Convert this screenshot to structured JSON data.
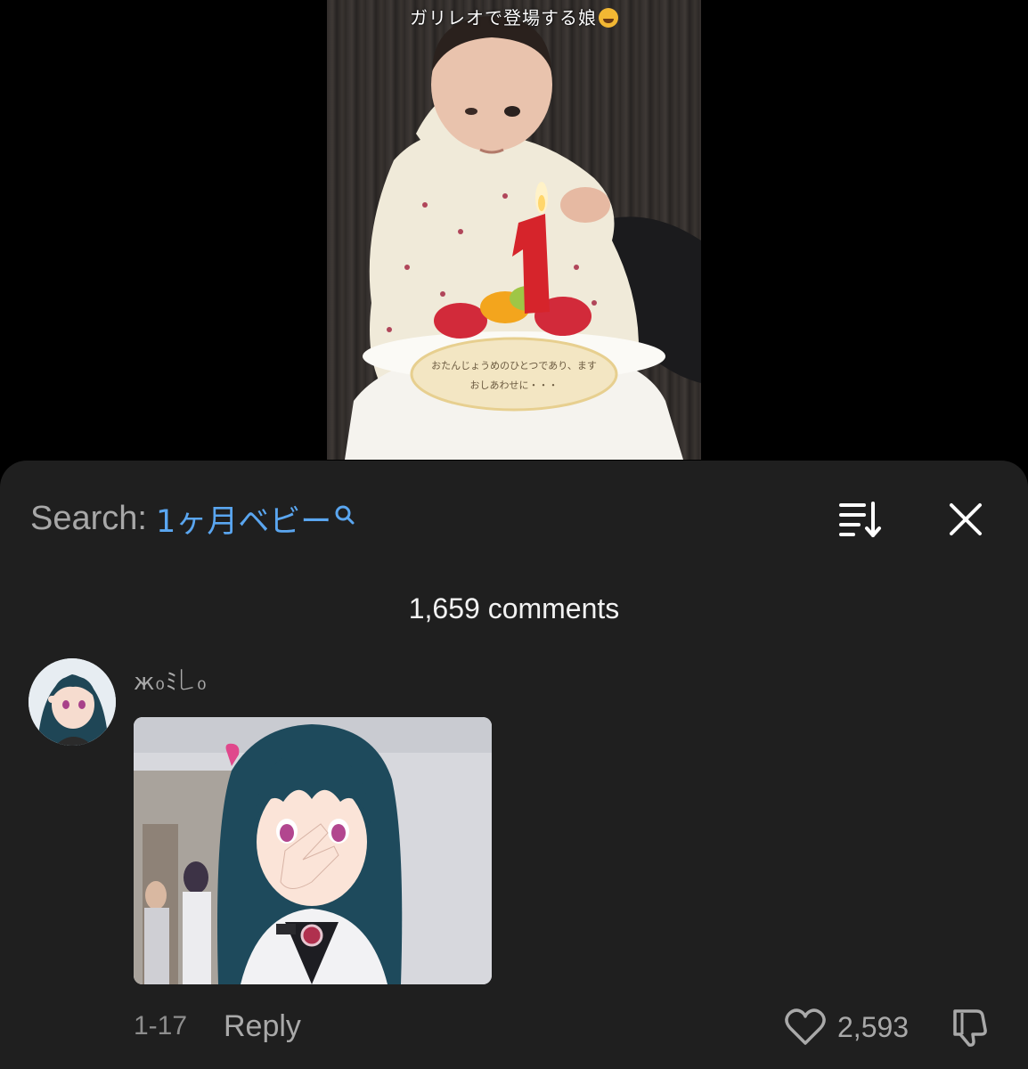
{
  "video": {
    "caption": "ガリレオで登場する娘",
    "caption_emoji": "rolling-on-floor-laughing-emoji",
    "plaque_line1": "おたんじょうめのひとつであり、ます",
    "plaque_line2": "おしあわせに・・・",
    "candle_number": "1"
  },
  "search": {
    "label": "Search:",
    "query": "1ヶ月ベビー",
    "icon": "search-icon"
  },
  "header_icons": {
    "sort": "sort-icon",
    "close": "close-icon"
  },
  "comments": {
    "count_text": "1,659 comments",
    "items": [
      {
        "username": "ж₀ﾐ꒒₀",
        "avatar": "anime-character-avatar",
        "has_image": true,
        "date": "1-17",
        "reply_label": "Reply",
        "likes": "2,593",
        "like_icon": "heart-icon",
        "dislike_icon": "thumbs-down-icon"
      }
    ]
  },
  "colors": {
    "sheet_background": "#1f1f1f",
    "search_accent": "#5aa6f0",
    "muted_text": "#a9a9a9"
  }
}
